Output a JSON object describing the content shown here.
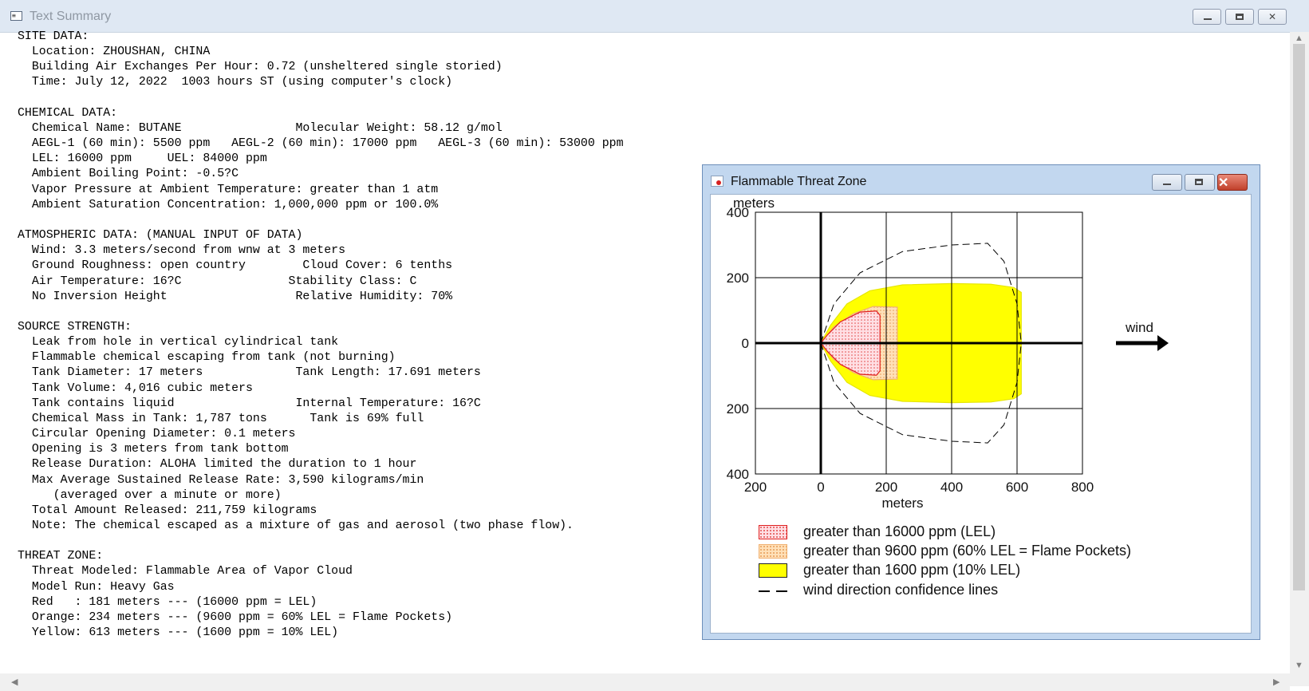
{
  "window": {
    "title": "Text Summary",
    "controls": [
      "minimize",
      "maximize",
      "close"
    ]
  },
  "summary_lines": [
    "SITE DATA:",
    "  Location: ZHOUSHAN, CHINA",
    "  Building Air Exchanges Per Hour: 0.72 (unsheltered single storied)",
    "  Time: July 12, 2022  1003 hours ST (using computer's clock)",
    "",
    "CHEMICAL DATA:",
    "  Chemical Name: BUTANE                Molecular Weight: 58.12 g/mol",
    "  AEGL-1 (60 min): 5500 ppm   AEGL-2 (60 min): 17000 ppm   AEGL-3 (60 min): 53000 ppm",
    "  LEL: 16000 ppm     UEL: 84000 ppm",
    "  Ambient Boiling Point: -0.5?C",
    "  Vapor Pressure at Ambient Temperature: greater than 1 atm",
    "  Ambient Saturation Concentration: 1,000,000 ppm or 100.0%",
    "",
    "ATMOSPHERIC DATA: (MANUAL INPUT OF DATA)",
    "  Wind: 3.3 meters/second from wnw at 3 meters",
    "  Ground Roughness: open country        Cloud Cover: 6 tenths",
    "  Air Temperature: 16?C               Stability Class: C",
    "  No Inversion Height                  Relative Humidity: 70%",
    "",
    "SOURCE STRENGTH:",
    "  Leak from hole in vertical cylindrical tank",
    "  Flammable chemical escaping from tank (not burning)",
    "  Tank Diameter: 17 meters             Tank Length: 17.691 meters",
    "  Tank Volume: 4,016 cubic meters",
    "  Tank contains liquid                 Internal Temperature: 16?C",
    "  Chemical Mass in Tank: 1,787 tons      Tank is 69% full",
    "  Circular Opening Diameter: 0.1 meters",
    "  Opening is 3 meters from tank bottom",
    "  Release Duration: ALOHA limited the duration to 1 hour",
    "  Max Average Sustained Release Rate: 3,590 kilograms/min",
    "     (averaged over a minute or more)",
    "  Total Amount Released: 211,759 kilograms",
    "  Note: The chemical escaped as a mixture of gas and aerosol (two phase flow).",
    "",
    "THREAT ZONE:",
    "  Threat Modeled: Flammable Area of Vapor Cloud",
    "  Model Run: Heavy Gas",
    "  Red   : 181 meters --- (16000 ppm = LEL)",
    "  Orange: 234 meters --- (9600 ppm = 60% LEL = Flame Pockets)",
    "  Yellow: 613 meters --- (1600 ppm = 10% LEL)"
  ],
  "threat_window": {
    "title": "Flammable Threat Zone",
    "controls": [
      "minimize",
      "maximize",
      "close"
    ],
    "wind_label": "wind"
  },
  "chart_data": {
    "type": "area",
    "title": "Flammable Threat Zone",
    "xlabel": "meters",
    "ylabel": "meters",
    "xlim": [
      -200,
      800
    ],
    "ylim": [
      -400,
      400
    ],
    "x_ticks": [
      -200,
      0,
      200,
      400,
      600,
      800
    ],
    "x_tick_labels": [
      "200",
      "0",
      "200",
      "400",
      "600",
      "800"
    ],
    "y_ticks": [
      400,
      200,
      0,
      -200,
      -400
    ],
    "y_tick_labels": [
      "400",
      "200",
      "0",
      "200",
      "400"
    ],
    "grid": true,
    "wind_direction": "positive x",
    "zones": [
      {
        "name": "greater than 1600 ppm (10% LEL)",
        "color": "#ffff00",
        "edge": "#e6e600",
        "pattern": "solid",
        "points": [
          [
            0,
            0
          ],
          [
            30,
            55
          ],
          [
            80,
            120
          ],
          [
            150,
            160
          ],
          [
            250,
            178
          ],
          [
            400,
            182
          ],
          [
            520,
            180
          ],
          [
            590,
            170
          ],
          [
            613,
            155
          ],
          [
            613,
            -155
          ],
          [
            590,
            -170
          ],
          [
            520,
            -180
          ],
          [
            400,
            -182
          ],
          [
            250,
            -178
          ],
          [
            150,
            -160
          ],
          [
            80,
            -120
          ],
          [
            30,
            -55
          ]
        ]
      },
      {
        "name": "greater than 9600 ppm (60% LEL = Flame Pockets)",
        "color": "#ffd8a8",
        "edge": "#f0b070",
        "pattern": "dotted",
        "points": [
          [
            0,
            0
          ],
          [
            40,
            50
          ],
          [
            100,
            90
          ],
          [
            160,
            112
          ],
          [
            234,
            110
          ],
          [
            234,
            -110
          ],
          [
            160,
            -112
          ],
          [
            100,
            -90
          ],
          [
            40,
            -50
          ]
        ]
      },
      {
        "name": "greater than 16000 ppm (LEL)",
        "color": "#ffd0d8",
        "edge": "#e02020",
        "pattern": "dotted",
        "points": [
          [
            0,
            0
          ],
          [
            20,
            25
          ],
          [
            60,
            65
          ],
          [
            120,
            95
          ],
          [
            170,
            98
          ],
          [
            181,
            85
          ],
          [
            181,
            -85
          ],
          [
            170,
            -98
          ],
          [
            120,
            -95
          ],
          [
            60,
            -65
          ],
          [
            20,
            -25
          ]
        ]
      }
    ],
    "confidence_lines": {
      "name": "wind direction confidence lines",
      "style": "dashed",
      "upper": [
        [
          0,
          0
        ],
        [
          40,
          120
        ],
        [
          120,
          215
        ],
        [
          250,
          280
        ],
        [
          400,
          300
        ],
        [
          510,
          305
        ],
        [
          560,
          250
        ],
        [
          600,
          120
        ],
        [
          613,
          0
        ]
      ],
      "lower": [
        [
          0,
          0
        ],
        [
          40,
          -120
        ],
        [
          120,
          -215
        ],
        [
          250,
          -280
        ],
        [
          400,
          -300
        ],
        [
          510,
          -305
        ],
        [
          560,
          -250
        ],
        [
          600,
          -120
        ],
        [
          613,
          0
        ]
      ]
    },
    "legend": [
      {
        "label": "greater than 16000 ppm (LEL)",
        "swatch": "red-dotted"
      },
      {
        "label": "greater than 9600 ppm (60% LEL = Flame Pockets)",
        "swatch": "orange-dotted"
      },
      {
        "label": "greater than 1600 ppm (10% LEL)",
        "swatch": "yellow-solid"
      },
      {
        "label": "wind direction confidence lines",
        "swatch": "dashed-line"
      }
    ]
  }
}
